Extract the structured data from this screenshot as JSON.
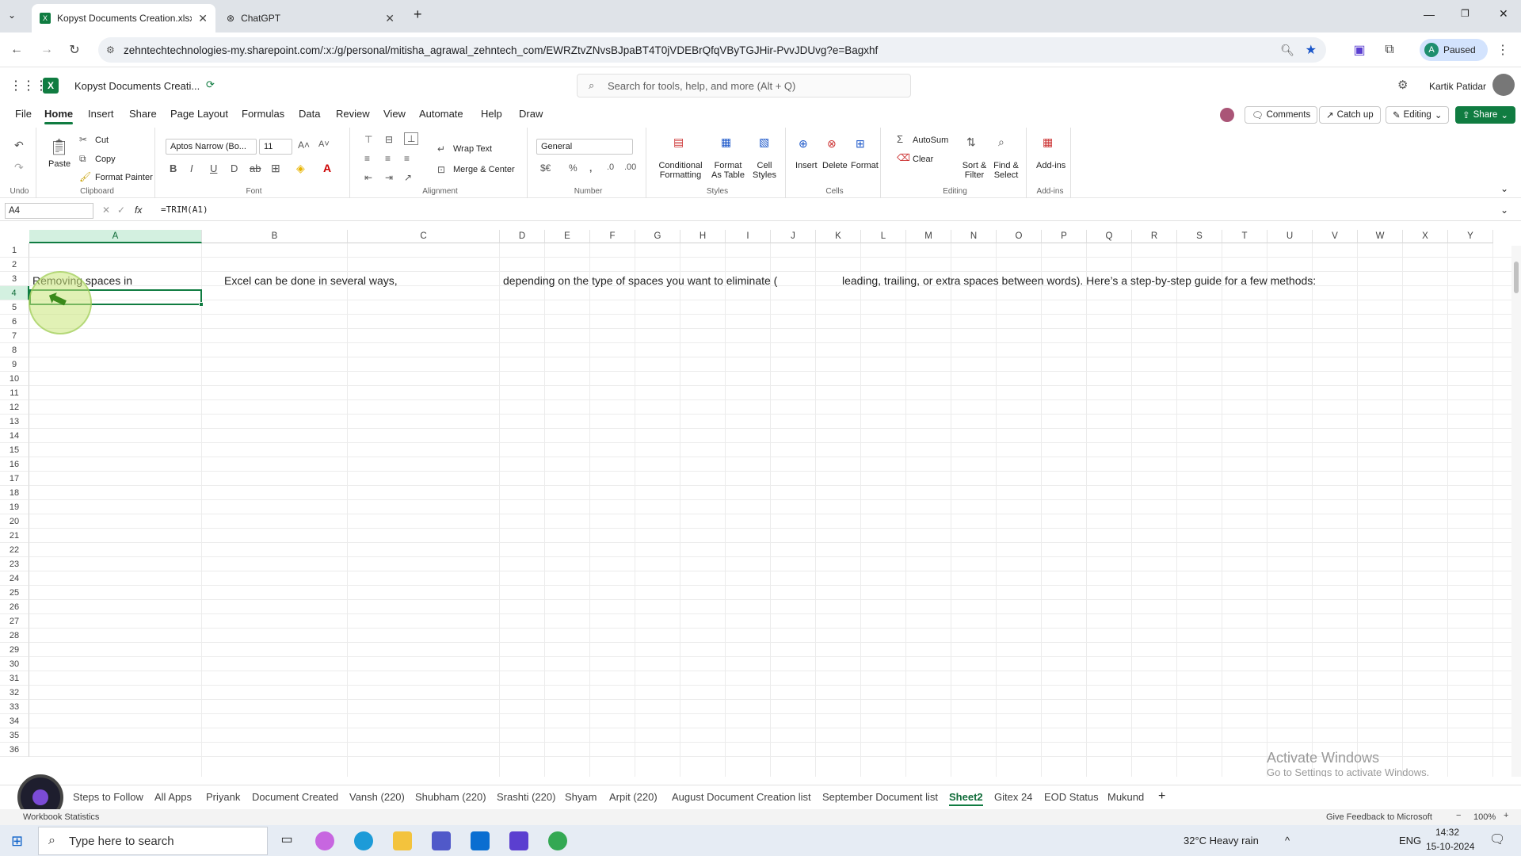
{
  "browser": {
    "tabs": [
      {
        "title": "Kopyst Documents Creation.xlsx"
      },
      {
        "title": "ChatGPT"
      }
    ],
    "url": "zehntechtechnologies-my.sharepoint.com/:x:/g/personal/mitisha_agrawal_zehntech_com/EWRZtvZNvsBJpaBT4T0jVDEBrQfqVByTGJHir-PvvJDUvg?e=Bagxhf",
    "profile_status": "Paused",
    "profile_initial": "A"
  },
  "app": {
    "doc_title": "Kopyst Documents Creati...",
    "search_placeholder": "Search for tools, help, and more (Alt + Q)",
    "user_name": "Kartik Patidar",
    "menus": [
      "File",
      "Home",
      "Insert",
      "Share",
      "Page Layout",
      "Formulas",
      "Data",
      "Review",
      "View",
      "Automate",
      "Help",
      "Draw"
    ],
    "active_menu": "Home",
    "comments_label": "Comments",
    "catchup_label": "Catch up",
    "editing_label": "Editing",
    "share_label": "Share"
  },
  "ribbon": {
    "undo_label": "Undo",
    "paste_label": "Paste",
    "cut_label": "Cut",
    "copy_label": "Copy",
    "format_painter_label": "Format Painter",
    "clipboard_label": "Clipboard",
    "font_name": "Aptos Narrow (Bo...",
    "font_size": "11",
    "font_label": "Font",
    "wrap_text_label": "Wrap Text",
    "merge_center_label": "Merge & Center",
    "alignment_label": "Alignment",
    "number_format": "General",
    "number_label": "Number",
    "conditional_formatting_label": "Conditional Formatting",
    "format_as_table_label": "Format As Table",
    "cell_styles_label": "Cell Styles",
    "styles_label": "Styles",
    "insert_label": "Insert",
    "delete_label": "Delete",
    "format_label": "Format",
    "cells_label": "Cells",
    "autosum_label": "AutoSum",
    "clear_label": "Clear",
    "sort_filter_label": "Sort & Filter",
    "find_select_label": "Find & Select",
    "editing_group_label": "Editing",
    "addins_label": "Add-ins",
    "addins_group_label": "Add-ins"
  },
  "formula_bar": {
    "name_box": "A4",
    "formula": "=TRIM(A1)"
  },
  "grid": {
    "columns": [
      "A",
      "B",
      "C",
      "D",
      "E",
      "F",
      "G",
      "H",
      "I",
      "J",
      "K",
      "L",
      "M",
      "N",
      "O",
      "P",
      "Q",
      "R",
      "S",
      "T",
      "U",
      "V",
      "W",
      "X",
      "Y"
    ],
    "rows": [
      "1",
      "2",
      "3",
      "4",
      "5",
      "6",
      "7",
      "8",
      "9",
      "10",
      "11",
      "12",
      "13",
      "14",
      "15",
      "16",
      "17",
      "18",
      "19",
      "20",
      "21",
      "22",
      "23",
      "24",
      "25",
      "26",
      "27",
      "28",
      "29",
      "30",
      "31",
      "32",
      "33",
      "34",
      "35",
      "36"
    ],
    "cells": {
      "A3": "Removing spaces in",
      "B3": "Excel can be done in several ways,",
      "D3": "depending on the type of spaces you want to eliminate (",
      "K3": "leading, trailing, or extra spaces between words). Here’s a step-by-step guide for a few methods:"
    },
    "watermark_title": "Activate Windows",
    "watermark_sub": "Go to Settings to activate Windows."
  },
  "sheets": {
    "tabs": [
      "Steps to Follow",
      "All Apps",
      "Priyank",
      "Document Created",
      "Vansh (220)",
      "Shubham (220)",
      "Srashti (220)",
      "Shyam",
      "Arpit (220)",
      "August Document Creation list",
      "September Document list",
      "Sheet2",
      "Gitex 24",
      "EOD Status",
      "Mukund"
    ],
    "active": "Sheet2"
  },
  "status": {
    "left": "Workbook Statistics",
    "feedback": "Give Feedback to Microsoft",
    "zoom": "100%"
  },
  "taskbar": {
    "search_placeholder": "Type here to search",
    "weather": "32°C  Heavy rain",
    "lang": "ENG",
    "time": "14:32",
    "date": "15-10-2024"
  }
}
